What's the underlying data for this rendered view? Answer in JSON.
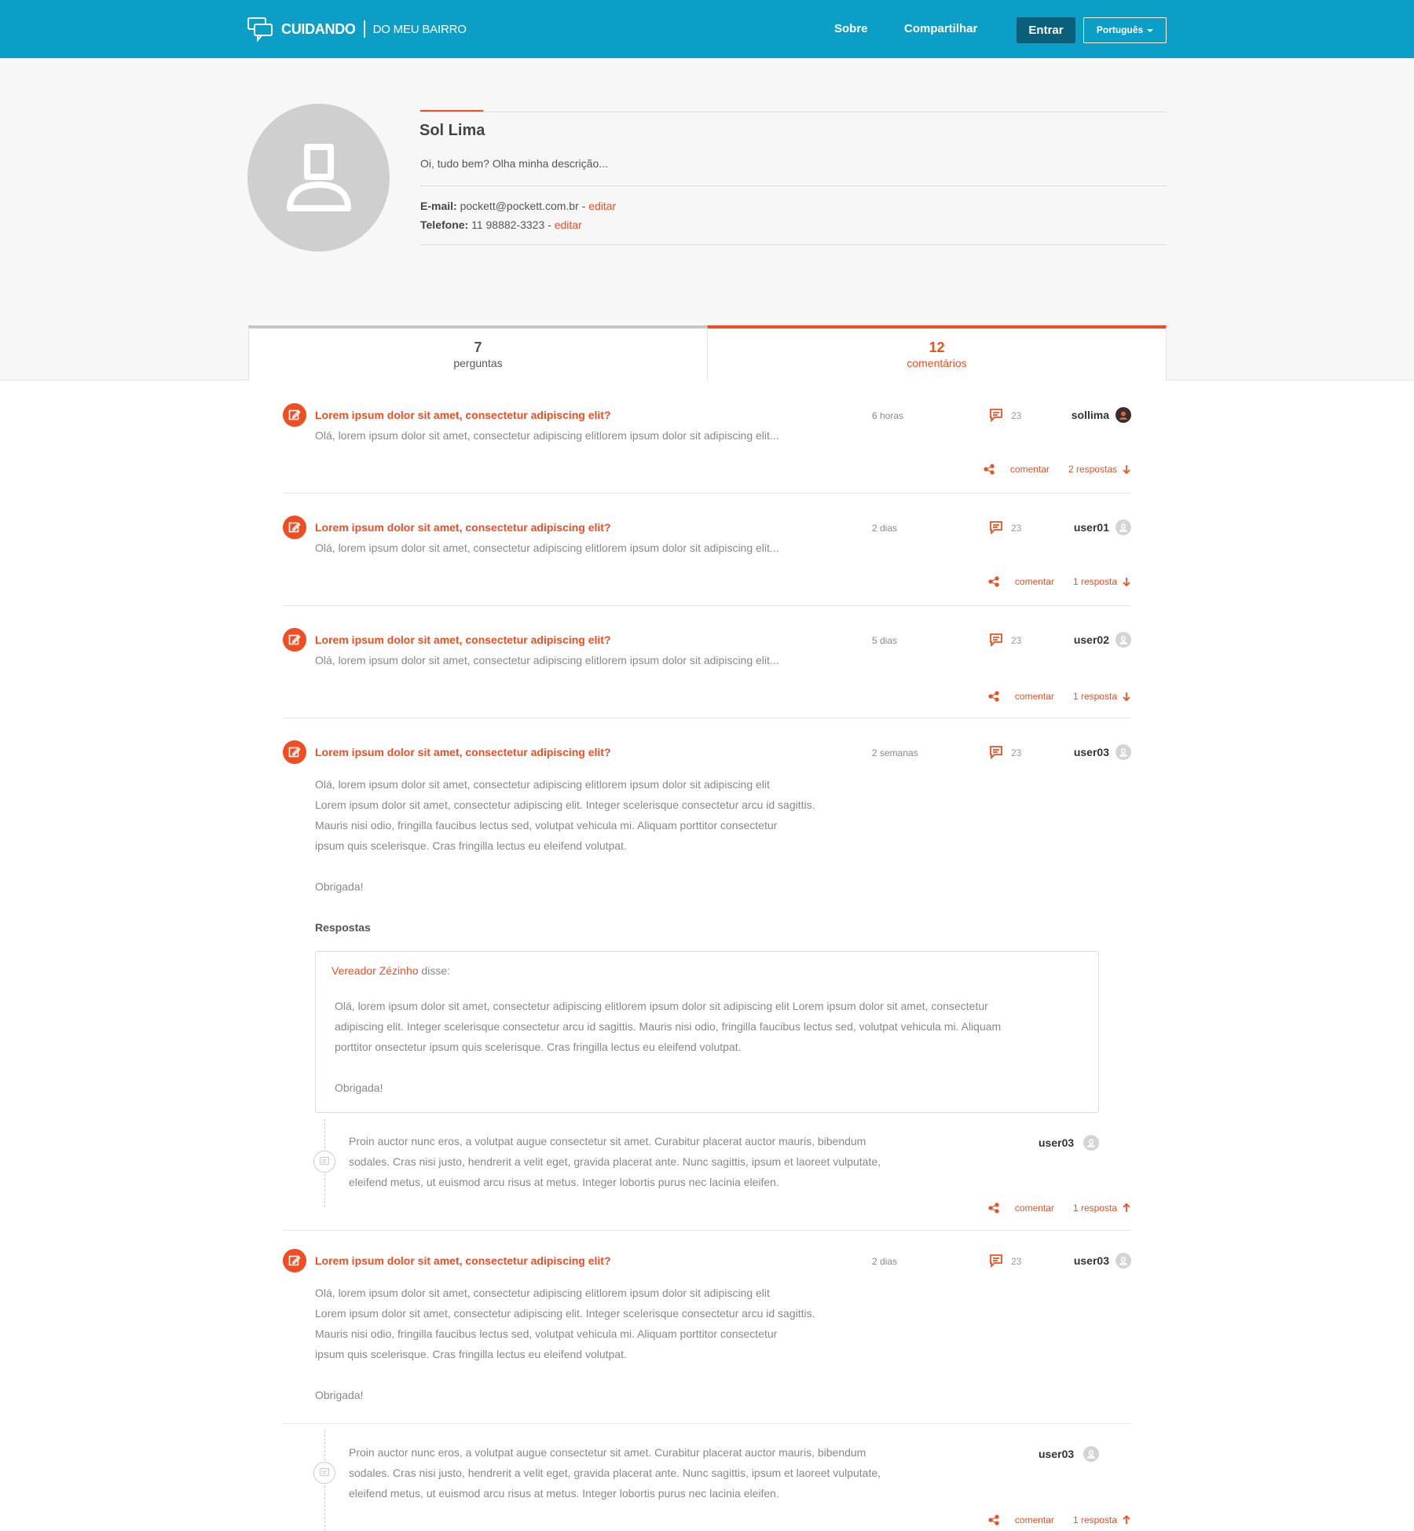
{
  "header": {
    "brand": "CUIDANDO",
    "tagline": "DO MEU BAIRRO",
    "nav": [
      "Sobre",
      "Compartilhar"
    ],
    "login_label": "Entrar",
    "language": "Português",
    "bg_color": "#0b9ec7"
  },
  "profile": {
    "name": "Sol Lima",
    "description": "Oi, tudo bem? Olha minha descrição...",
    "email_label": "E-mail:",
    "email": "pockett@pockett.com.br",
    "phone_label": "Telefone:",
    "phone": "11 98882-3323",
    "edit_label": "editar",
    "separator": "-"
  },
  "tabs": {
    "questions": {
      "count": "7",
      "label": "perguntas"
    },
    "comments": {
      "count": "12",
      "label": "comentários"
    }
  },
  "accent_color": "#ef4e23",
  "items": [
    {
      "title": "Lorem ipsum dolor sit amet, consectetur adipiscing elit?",
      "time": "6 horas",
      "comments": "23",
      "user": "sollima",
      "body": "Olá, lorem ipsum dolor sit amet, consectetur adipiscing elitlorem ipsum dolor sit adipiscing elit...",
      "comment_label": "comentar",
      "replies_label": "2 respostas"
    },
    {
      "title": "Lorem ipsum dolor sit amet, consectetur adipiscing elit?",
      "time": "2 dias",
      "comments": "23",
      "user": "user01",
      "body": "Olá, lorem ipsum dolor sit amet, consectetur adipiscing elitlorem ipsum dolor sit adipiscing elit...",
      "comment_label": "comentar",
      "replies_label": "1 resposta"
    },
    {
      "title": "Lorem ipsum dolor sit amet, consectetur adipiscing elit?",
      "time": "5 dias",
      "comments": "23",
      "user": "user02",
      "body": "Olá, lorem ipsum dolor sit amet, consectetur adipiscing elitlorem ipsum dolor sit adipiscing elit...",
      "comment_label": "comentar",
      "replies_label": "1 resposta"
    },
    {
      "title": "Lorem ipsum dolor sit amet, consectetur adipiscing elit?",
      "time": "2 semanas",
      "comments": "23",
      "user": "user03",
      "body_lines": [
        "Olá, lorem ipsum dolor sit amet, consectetur adipiscing elitlorem ipsum dolor sit adipiscing elit",
        "Lorem ipsum dolor sit amet, consectetur adipiscing elit. Integer scelerisque consectetur arcu id sagittis.",
        "Mauris nisi odio, fringilla faucibus lectus sed, volutpat vehicula mi. Aliquam porttitor consectetur",
        "ipsum quis scelerisque. Cras fringilla lectus eu eleifend volutpat."
      ],
      "signoff": "Obrigada!",
      "responses_heading": "Respostas",
      "official_reply": {
        "author": "Vereador Zézinho",
        "said": "disse:",
        "lines": [
          "Olá, lorem ipsum dolor sit amet, consectetur adipiscing elitlorem ipsum dolor sit adipiscing elit Lorem ipsum dolor sit amet, consectetur",
          "adipiscing elit. Integer scelerisque consectetur arcu id sagittis. Mauris nisi odio, fringilla faucibus lectus sed, volutpat vehicula mi. Aliquam",
          "porttitor onsectetur ipsum quis scelerisque. Cras fringilla lectus eu eleifend volutpat."
        ],
        "signoff": "Obrigada!"
      },
      "thread": {
        "user": "user03",
        "lines": [
          "Proin auctor nunc eros, a volutpat augue consectetur sit amet. Curabitur placerat auctor mauris, bibendum",
          "sodales. Cras nisi justo, hendrerit a velit eget, gravida placerat ante. Nunc sagittis, ipsum et laoreet vulputate,",
          "eleifend metus, ut euismod arcu risus at metus. Integer lobortis purus nec lacinia eleifen."
        ]
      },
      "comment_label": "comentar",
      "replies_label": "1 resposta"
    },
    {
      "title": "Lorem ipsum dolor sit amet, consectetur adipiscing elit?",
      "time": "2 dias",
      "comments": "23",
      "user": "user03",
      "body_lines": [
        "Olá, lorem ipsum dolor sit amet, consectetur adipiscing elitlorem ipsum dolor sit adipiscing elit",
        "Lorem ipsum dolor sit amet, consectetur adipiscing elit. Integer scelerisque consectetur arcu id sagittis.",
        "Mauris nisi odio, fringilla faucibus lectus sed, volutpat vehicula mi. Aliquam porttitor consectetur",
        "ipsum quis scelerisque. Cras fringilla lectus eu eleifend volutpat."
      ],
      "signoff": "Obrigada!",
      "thread": {
        "user": "user03",
        "lines": [
          "Proin auctor nunc eros, a volutpat augue consectetur sit amet. Curabitur placerat auctor mauris, bibendum",
          "sodales. Cras nisi justo, hendrerit a velit eget, gravida placerat ante. Nunc sagittis, ipsum et laoreet vulputate,",
          "eleifend metus, ut euismod arcu risus at metus. Integer lobortis purus nec lacinia eleifen."
        ]
      },
      "comment_label": "comentar",
      "replies_label": "1 resposta"
    }
  ]
}
